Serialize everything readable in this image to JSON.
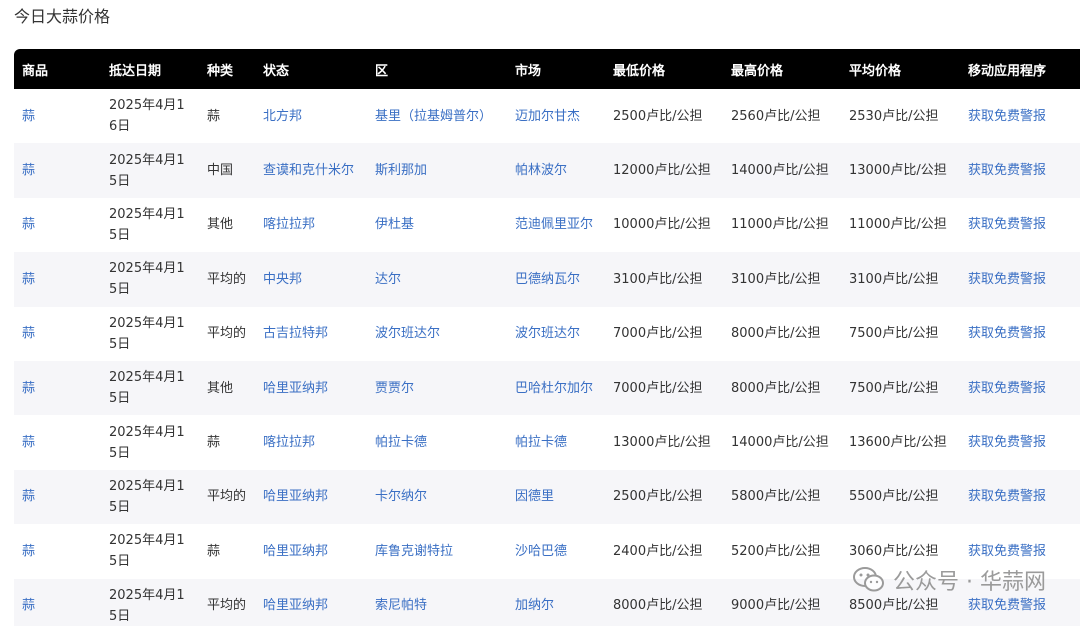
{
  "page": {
    "title": "今日大蒜价格"
  },
  "table": {
    "headers": [
      "商品",
      "抵达日期",
      "种类",
      "状态",
      "区",
      "市场",
      "最低价格",
      "最高价格",
      "平均价格",
      "移动应用程序"
    ],
    "rows": [
      {
        "commodity": "蒜",
        "date": "2025年4月16日",
        "variety": "蒜",
        "state": "北方邦",
        "district": "基里（拉基姆普尔）",
        "market": "迈加尔甘杰",
        "min": "2500卢比/公担",
        "max": "2560卢比/公担",
        "avg": "2530卢比/公担",
        "app": "获取免费警报"
      },
      {
        "commodity": "蒜",
        "date": "2025年4月15日",
        "variety": "中国",
        "state": "查谟和克什米尔",
        "district": "斯利那加",
        "market": "帕林波尔",
        "min": "12000卢比/公担",
        "max": "14000卢比/公担",
        "avg": "13000卢比/公担",
        "app": "获取免费警报"
      },
      {
        "commodity": "蒜",
        "date": "2025年4月15日",
        "variety": "其他",
        "state": "喀拉拉邦",
        "district": "伊杜基",
        "market": "范迪佩里亚尔",
        "min": "10000卢比/公担",
        "max": "11000卢比/公担",
        "avg": "11000卢比/公担",
        "app": "获取免费警报"
      },
      {
        "commodity": "蒜",
        "date": "2025年4月15日",
        "variety": "平均的",
        "state": "中央邦",
        "district": "达尔",
        "market": "巴德纳瓦尔",
        "min": "3100卢比/公担",
        "max": "3100卢比/公担",
        "avg": "3100卢比/公担",
        "app": "获取免费警报"
      },
      {
        "commodity": "蒜",
        "date": "2025年4月15日",
        "variety": "平均的",
        "state": "古吉拉特邦",
        "district": "波尔班达尔",
        "market": "波尔班达尔",
        "min": "7000卢比/公担",
        "max": "8000卢比/公担",
        "avg": "7500卢比/公担",
        "app": "获取免费警报"
      },
      {
        "commodity": "蒜",
        "date": "2025年4月15日",
        "variety": "其他",
        "state": "哈里亚纳邦",
        "district": "贾贾尔",
        "market": "巴哈杜尔加尔",
        "min": "7000卢比/公担",
        "max": "8000卢比/公担",
        "avg": "7500卢比/公担",
        "app": "获取免费警报"
      },
      {
        "commodity": "蒜",
        "date": "2025年4月15日",
        "variety": "蒜",
        "state": "喀拉拉邦",
        "district": "帕拉卡德",
        "market": "帕拉卡德",
        "min": "13000卢比/公担",
        "max": "14000卢比/公担",
        "avg": "13600卢比/公担",
        "app": "获取免费警报"
      },
      {
        "commodity": "蒜",
        "date": "2025年4月15日",
        "variety": "平均的",
        "state": "哈里亚纳邦",
        "district": "卡尔纳尔",
        "market": "因德里",
        "min": "2500卢比/公担",
        "max": "5800卢比/公担",
        "avg": "5500卢比/公担",
        "app": "获取免费警报"
      },
      {
        "commodity": "蒜",
        "date": "2025年4月15日",
        "variety": "蒜",
        "state": "哈里亚纳邦",
        "district": "库鲁克谢特拉",
        "market": "沙哈巴德",
        "min": "2400卢比/公担",
        "max": "5200卢比/公担",
        "avg": "3060卢比/公担",
        "app": "获取免费警报"
      },
      {
        "commodity": "蒜",
        "date": "2025年4月15日",
        "variety": "平均的",
        "state": "哈里亚纳邦",
        "district": "索尼帕特",
        "market": "加纳尔",
        "min": "8000卢比/公担",
        "max": "9000卢比/公担",
        "avg": "8500卢比/公担",
        "app": "获取免费警报"
      }
    ]
  },
  "watermark": {
    "text": "公众号 · 华蒜网",
    "icon": "wechat-icon"
  }
}
